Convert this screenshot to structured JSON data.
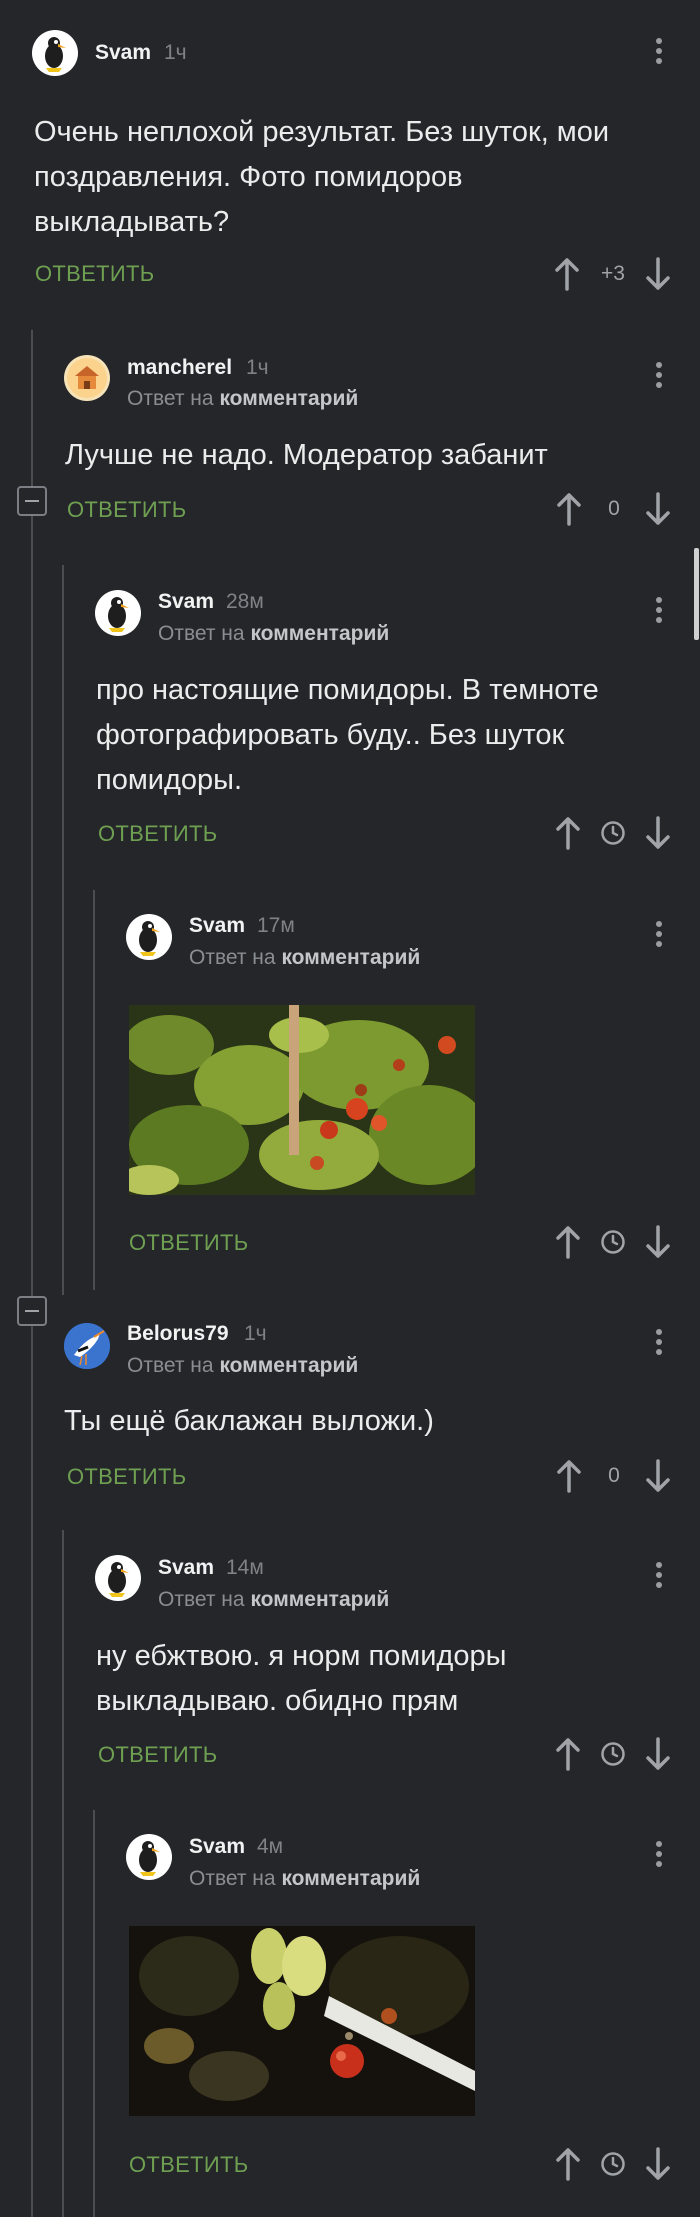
{
  "labels": {
    "reply": "ОТВЕТИТЬ",
    "reply_prefix": "Ответ на",
    "reply_target": "комментарий"
  },
  "icons": {
    "upvote": "arrow-up-icon",
    "downvote": "arrow-down-icon",
    "menu": "more-vertical-icon",
    "pending": "clock-icon",
    "collapse": "collapse-thread-icon"
  },
  "comments": [
    {
      "user": "Svam",
      "time": "1ч",
      "text": "Очень неплохой результат. Без шуток, мои поздравления. Фото помидоров выкладывать?",
      "score": "+3"
    },
    {
      "user": "mancherel",
      "time": "1ч",
      "text": "Лучше не надо. Модератор забанит",
      "score": "0"
    },
    {
      "user": "Svam",
      "time": "28м",
      "text": "про настоящие помидоры. В темноте фотографировать буду.. Без шуток помидоры.",
      "score": ""
    },
    {
      "user": "Svam",
      "time": "17м",
      "text": "",
      "score": ""
    },
    {
      "user": "Belorus79",
      "time": "1ч",
      "text": "Ты ещё баклажан выложи.)",
      "score": "0"
    },
    {
      "user": "Svam",
      "time": "14м",
      "text": "ну ебжтвою. я норм помидоры выкладываю. обидно прям",
      "score": ""
    },
    {
      "user": "Svam",
      "time": "4м",
      "text": "",
      "score": ""
    }
  ]
}
